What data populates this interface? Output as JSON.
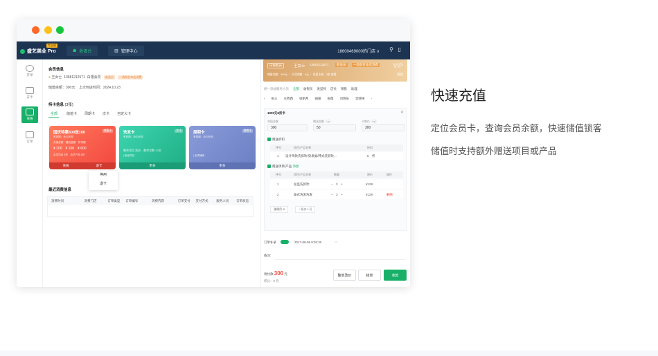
{
  "app": {
    "logo": "盛艺美业 Pro",
    "edition": "专业版",
    "tab_register": "收银台",
    "tab_admin": "管理中心",
    "store": "18600469000的门店 ∨"
  },
  "sidebar": {
    "items": [
      {
        "label": "开单"
      },
      {
        "label": "开卡"
      },
      {
        "label": "充值"
      },
      {
        "label": "订单"
      }
    ]
  },
  "member": {
    "section_title": "会员信息",
    "name": "王女士",
    "phone": "13681212571",
    "level": "白银会员",
    "tag1": "新会员",
    "tag2": "一周前在本店消费",
    "balance": "储值余额：300元",
    "last_visit": "上次到店时间：2024.10.23"
  },
  "cards": {
    "section_title": "持卡信息",
    "count": "(3张)",
    "filters": [
      "全部",
      "储值卡",
      "周期卡",
      "次卡",
      "自定义卡"
    ],
    "card1": {
      "name": "国庆特惠500送100",
      "type": "储值卡",
      "sub": "有效期：永久有效",
      "row1": "充值金额　赠送金额　折扣额",
      "row2": "¥ 200　¥ 100　¥ 600",
      "row3": "会员项目 8折　会员产品 8折",
      "btn_recharge": "充值",
      "btn_return": "退卡"
    },
    "card2": {
      "name": "洗发卡",
      "type": "次卡",
      "sub": "有效期：永久有效",
      "row1": "剩余项目 洗发　剩余次数 10次",
      "row2": "| 指定项目",
      "btn_more": "更多"
    },
    "card3": {
      "name": "周期卡",
      "type": "周期卡",
      "sub": "有效期：永久有效",
      "row1": "| 全项通用",
      "btn_more": "更多"
    }
  },
  "popup": {
    "items": [
      "停用",
      "退卡"
    ]
  },
  "history": {
    "section_title": "最近消费信息",
    "columns": [
      "消费时间",
      "消费门店",
      "订单类型",
      "订单编号",
      "消费内容",
      "订单支付",
      "支付方式",
      "服务人员",
      "订单状态"
    ]
  },
  "recharge": {
    "member_level": "白银会员",
    "member_name": "王女士",
    "member_phone": "13681212571",
    "badge1": "新会员",
    "badge2": "一周前在本店消费",
    "vip_mark": "VIP",
    "card_info": "储值余额：300元 ｜ 卡项余额：0元 ｜ 优惠卡券：3张 查看",
    "exit": "退出",
    "staff_label": "统一添加服务人员",
    "staff_tabs": [
      "全部",
      "收银员",
      "发型师",
      "店长",
      "销售",
      "助理"
    ],
    "staff_names": [
      "张三",
      "王西西",
      "张明月",
      "田田",
      "张薇",
      "刘晓乐",
      "李晓梅"
    ],
    "card_title": "1000元5折卡",
    "f1_label": "充值金额",
    "f1_value": "300",
    "f2_label": "赠送金额（元）",
    "f2_value": "50",
    "f3_label": "卡售价（元）",
    "f3_value": "300",
    "gift_discount": "赠送折扣",
    "disc_cols": [
      "序号",
      "项目/产品名称",
      "折扣"
    ],
    "disc_row": [
      "1",
      "设计师款洗剪吹/染发类/韩式洗剪吹...",
      "5　折"
    ],
    "gift_items": "赠送项目/产品",
    "add": "添加",
    "item_cols": [
      "序号",
      "项目/产品名称",
      "数量",
      "原价",
      "操作"
    ],
    "item_rows": [
      [
        "1",
        "总监洗剪吹",
        "−　2　+",
        "¥128",
        ""
      ],
      [
        "2",
        "泰式洗发洗发",
        "−　2　+",
        "¥128",
        "删除"
      ]
    ],
    "staff_chip": "张明月",
    "staff_add": "+ 服务人员",
    "order_fill": "订单补录",
    "date": "2017-08-08 9:30:30",
    "note_label": "备注:",
    "pay_label": "待付款",
    "pay_amount": "300",
    "pay_unit": "元",
    "points": "积分：0 元",
    "btn_discount": "整单改价",
    "btn_hold": "挂单",
    "btn_pay": "收款"
  },
  "feature": {
    "heading": "快速充值",
    "line1": "定位会员卡，查询会员余额，快速储值锁客",
    "line2": "储值时支持额外赠送项目或产品"
  }
}
